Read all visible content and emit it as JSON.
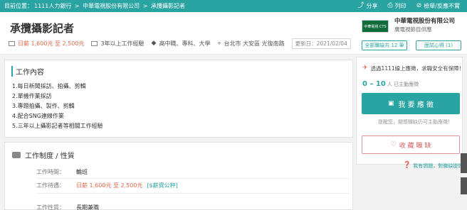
{
  "topbar": {
    "crumbs": [
      "目前位置：",
      "1111人力銀行",
      " > ",
      "中華電視股份有限公司",
      " > ",
      "承攬攝影記者"
    ],
    "share": "分享",
    "print": "列印",
    "report": "檢舉/反應不實"
  },
  "job": {
    "title": "承攬攝影記者",
    "salary": "日薪 1,600元 至 2,500元",
    "experience": "3年以上工作經驗",
    "education": "高中職、專科、大學",
    "location": "台北市 大安區 光復南路",
    "updated": "更新日：2021/02/04"
  },
  "company": {
    "logo_text": "中華電視 CTS",
    "name": "中華電視股份有限公司",
    "subtitle": "廣電視節目供應",
    "jobs_button": "全部職缺共 12 筆",
    "interview_button": "面試心得 (1)"
  },
  "content": {
    "heading": "工作內容",
    "items": [
      "1.每日新聞採訪、拍攝、剪輯",
      "2.單機作業採訪",
      "3.專題拍攝、製作、剪輯",
      "4.配合SNG連線作業",
      "5.三年以上攝影記者等相關工作經驗"
    ]
  },
  "system": {
    "heading": "工作制度 / 性質",
    "time_label": "工作時間：",
    "time_value": "輪班",
    "pay_label": "工作待遇：",
    "pay_value": "日薪 1,600元 至 2,500元",
    "pay_tag": "[$薪資公秤]",
    "nature_label": "工作性質：",
    "nature_value": "長期兼職"
  },
  "sidebar": {
    "note": "透過1111線上應徵，求職安全有保障！",
    "stat_value": "0 – 10",
    "stat_label": "人 已主動應徵",
    "apply": "我 要 應 徵",
    "reminder": "提醒您，關懷職缺仍可主動應徵！",
    "favorite": "收 藏 職 缺",
    "help": "我有問題，對職缺提問"
  }
}
